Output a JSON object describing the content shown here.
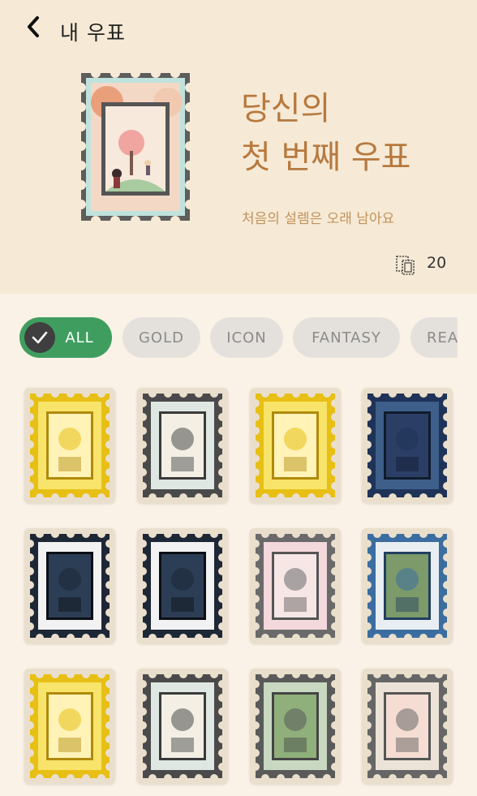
{
  "header": {
    "title": "내 우표",
    "headline_line1": "당신의",
    "headline_line2": "첫 번째 우표",
    "subtitle": "처음의 설렘은 오래 남아요",
    "count": "20"
  },
  "filters": [
    {
      "label": "ALL",
      "active": true
    },
    {
      "label": "GOLD",
      "active": false
    },
    {
      "label": "ICON",
      "active": false
    },
    {
      "label": "FANTASY",
      "active": false
    },
    {
      "label": "REAL",
      "active": false
    }
  ],
  "stamps": [
    {
      "name": "stamp-sword",
      "frame": "gold",
      "icon": "sword-icon"
    },
    {
      "name": "stamp-girl-in-dress",
      "frame": "pastel",
      "icon": "girl-dress-icon"
    },
    {
      "name": "stamp-lotus",
      "frame": "gold",
      "icon": "lotus-icon"
    },
    {
      "name": "stamp-night-cat",
      "frame": "navy",
      "icon": "night-cat-icon"
    },
    {
      "name": "stamp-rocket",
      "frame": "dark",
      "icon": "rocket-icon"
    },
    {
      "name": "stamp-dancer",
      "frame": "dark",
      "icon": "dancer-icon"
    },
    {
      "name": "stamp-bunny-girl",
      "frame": "pink",
      "icon": "bunny-girl-icon"
    },
    {
      "name": "stamp-vintage-car",
      "frame": "blue",
      "icon": "car-icon"
    },
    {
      "name": "stamp-gingerbread",
      "frame": "gold",
      "icon": "gingerbread-icon"
    },
    {
      "name": "stamp-teddy-bear",
      "frame": "pastel",
      "icon": "teddy-bear-icon"
    },
    {
      "name": "stamp-floating-island",
      "frame": "green",
      "icon": "floating-island-icon"
    },
    {
      "name": "stamp-fluffy-creature",
      "frame": "peach",
      "icon": "fluffy-creature-icon"
    }
  ],
  "colors": {
    "header_bg": "#f6ead6",
    "page_bg": "#faf2e6",
    "accent": "#b7793f",
    "active_chip": "#3f9e5f"
  }
}
